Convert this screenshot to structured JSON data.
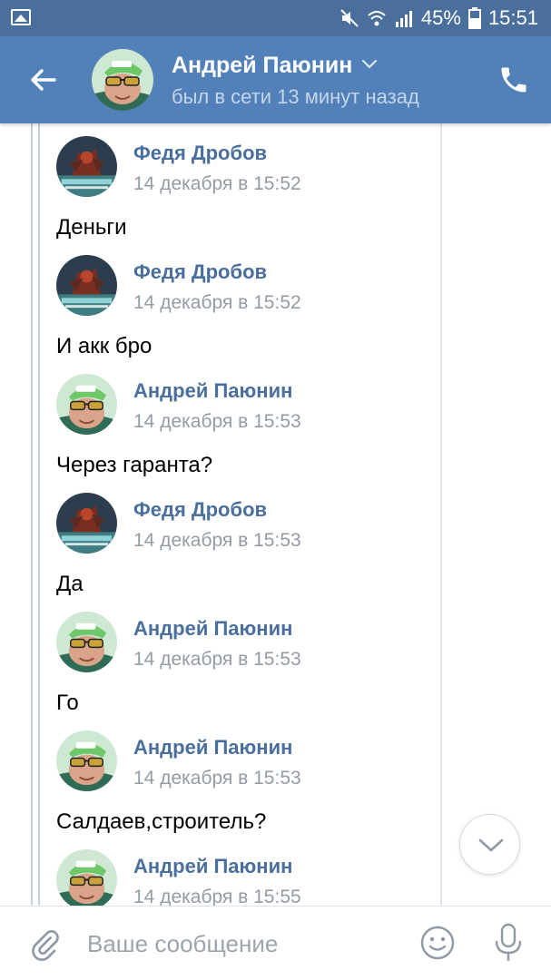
{
  "status_bar": {
    "battery": "45%",
    "time": "15:51",
    "icons": [
      "image-icon",
      "mute-icon",
      "wifi-icon",
      "signal-icon",
      "battery-icon"
    ]
  },
  "header": {
    "name": "Андрей Паюнин",
    "status": "был в сети 13 минут назад",
    "icons": [
      "back-arrow-icon",
      "chevron-down-icon",
      "phone-icon"
    ]
  },
  "messages": [
    {
      "author": "Федя Дробов",
      "date": "14 декабря в 15:52",
      "text": "Деньги",
      "avatar": "fedya"
    },
    {
      "author": "Федя Дробов",
      "date": "14 декабря в 15:52",
      "text": "И акк бро",
      "avatar": "fedya"
    },
    {
      "author": "Андрей Паюнин",
      "date": "14 декабря в 15:53",
      "text": "Через гаранта?",
      "avatar": "andrey"
    },
    {
      "author": "Федя Дробов",
      "date": "14 декабря в 15:53",
      "text": "Да",
      "avatar": "fedya"
    },
    {
      "author": "Андрей Паюнин",
      "date": "14 декабря в 15:53",
      "text": "Го",
      "avatar": "andrey"
    },
    {
      "author": "Андрей Паюнин",
      "date": "14 декабря в 15:53",
      "text": "Салдаев,строитель?",
      "avatar": "andrey"
    },
    {
      "author": "Андрей Паюнин",
      "date": "14 декабря в 15:55",
      "text": "",
      "avatar": "andrey"
    }
  ],
  "composer": {
    "placeholder": "Ваше сообщение",
    "icons": [
      "attach-icon",
      "smile-icon",
      "mic-icon"
    ]
  },
  "colors": {
    "status_bar": "#4a6f9c",
    "header": "#5181b8",
    "author_name": "#4a6f9c",
    "date": "#939ba5"
  }
}
